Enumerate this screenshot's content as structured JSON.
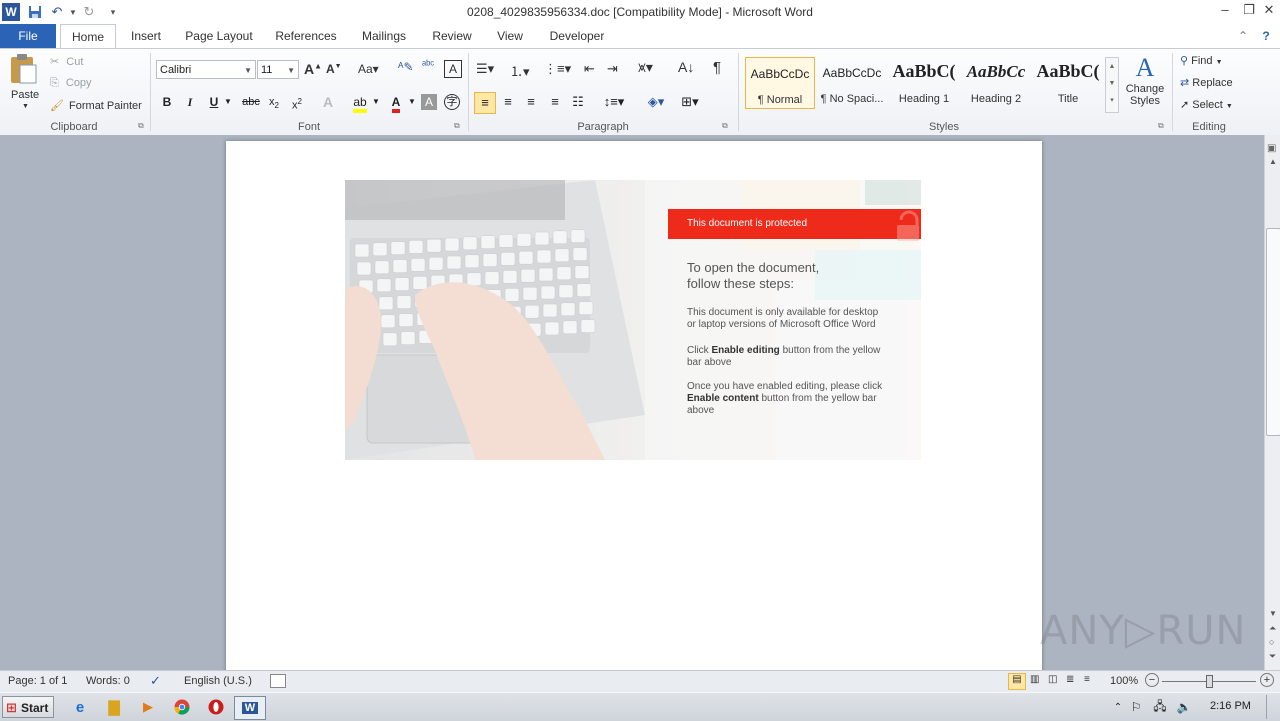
{
  "window": {
    "title": "0208_4029835956334.doc [Compatibility Mode]  -  Microsoft Word",
    "app_icon": "word-icon"
  },
  "tabs": [
    "File",
    "Home",
    "Insert",
    "Page Layout",
    "References",
    "Mailings",
    "Review",
    "View",
    "Developer"
  ],
  "active_tab": "Home",
  "ribbon": {
    "clipboard": {
      "label": "Clipboard",
      "paste": "Paste",
      "cut": "Cut",
      "copy": "Copy",
      "format_painter": "Format Painter"
    },
    "font": {
      "label": "Font",
      "font_name": "Calibri",
      "font_size": "11"
    },
    "paragraph": {
      "label": "Paragraph"
    },
    "styles": {
      "label": "Styles",
      "items": [
        {
          "sample": "AaBbCcDc",
          "name": "¶ Normal"
        },
        {
          "sample": "AaBbCcDc",
          "name": "¶ No Spaci..."
        },
        {
          "sample": "AaBbC(",
          "name": "Heading 1"
        },
        {
          "sample": "AaBbCc",
          "name": "Heading 2"
        },
        {
          "sample": "AaBbC(",
          "name": "Title"
        }
      ],
      "change_styles": "Change Styles"
    },
    "editing": {
      "label": "Editing",
      "find": "Find",
      "replace": "Replace",
      "select": "Select"
    }
  },
  "document": {
    "banner_header": "This document is protected",
    "heading_line1": "To open the document,",
    "heading_line2": "follow these steps:",
    "p1_line1": "This document is only available for desktop",
    "p1_line2": "or laptop versions of Microsoft Office Word",
    "p2_pre": "Click ",
    "p2_bold": "Enable editing",
    "p2_post": " button from the yellow",
    "p2_line2": "bar above",
    "p3_line1": "Once you have enabled editing, please click",
    "p3_bold": "Enable content",
    "p3_post": " button from the yellow bar",
    "p3_line3": "above",
    "accent_color": "#ee2a1b"
  },
  "statusbar": {
    "page": "Page: 1 of 1",
    "words": "Words: 0",
    "language": "English (U.S.)",
    "zoom": "100%"
  },
  "taskbar": {
    "start": "Start",
    "time": "2:16 PM"
  },
  "watermark": "ANY▷RUN"
}
